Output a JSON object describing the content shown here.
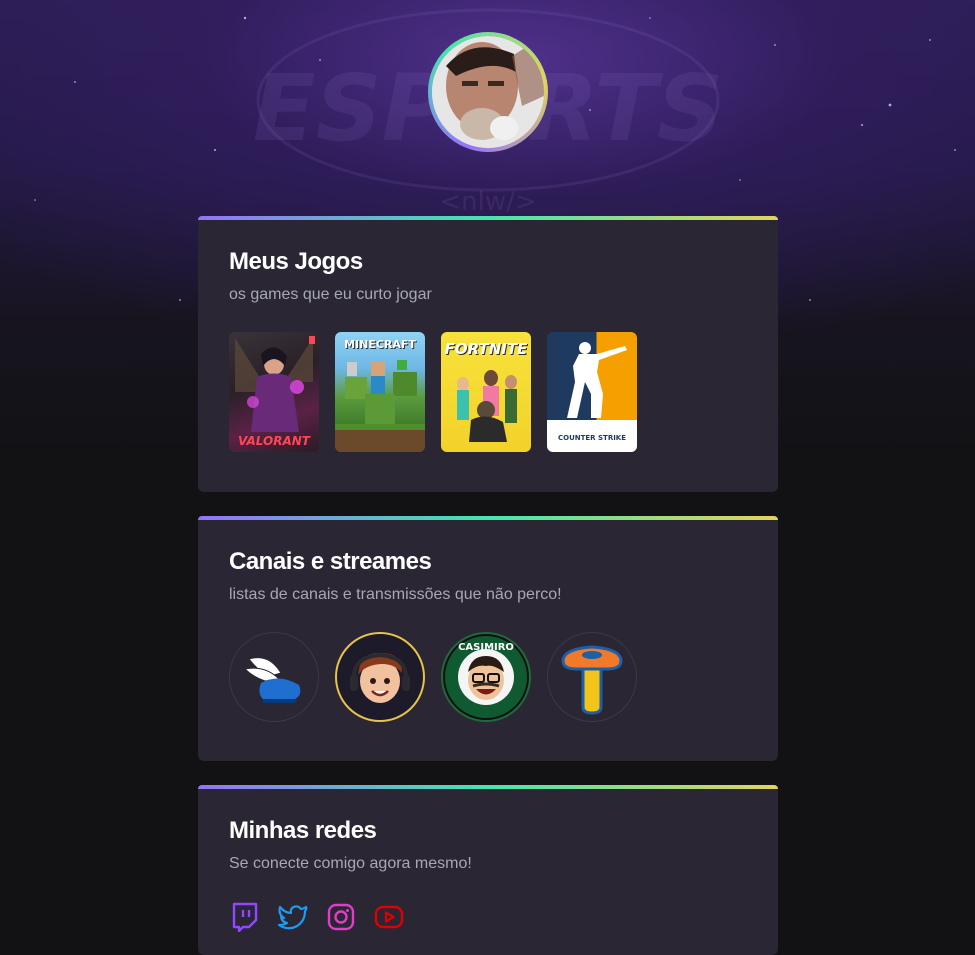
{
  "profile": {
    "avatar_alt": "profile photo"
  },
  "background": {
    "logo_text": "ESPORTS",
    "logo_sub": "<nlw/>"
  },
  "accent_gradient": [
    "#9572FC",
    "#43E7AD",
    "#E2D45C"
  ],
  "games_section": {
    "title": "Meus Jogos",
    "subtitle": "os games que eu curto jogar",
    "games": [
      {
        "name": "VALORANT",
        "icon": "valorant-cover"
      },
      {
        "name": "MINECRAFT",
        "icon": "minecraft-cover"
      },
      {
        "name": "FORTNITE",
        "icon": "fortnite-cover"
      },
      {
        "name": "COUNTER STRIKE",
        "icon": "counter-strike-cover"
      }
    ]
  },
  "channels_section": {
    "title": "Canais e streames",
    "subtitle": "listas de canais e transmissões que não perco!",
    "channels": [
      {
        "icon": "winged-shoe-avatar"
      },
      {
        "icon": "cartoon-boy-avatar"
      },
      {
        "name": "CASIMIRO",
        "icon": "casimiro-avatar"
      },
      {
        "icon": "mushroom-avatar"
      }
    ]
  },
  "social_section": {
    "title": "Minhas redes",
    "subtitle": "Se conecte comigo agora mesmo!",
    "links": [
      {
        "icon": "twitch-icon",
        "color": "#9147FF"
      },
      {
        "icon": "twitter-icon",
        "color": "#1D9BF0"
      },
      {
        "icon": "instagram-icon",
        "color": "#E23CC8"
      },
      {
        "icon": "youtube-icon",
        "color": "#E00000"
      }
    ]
  }
}
